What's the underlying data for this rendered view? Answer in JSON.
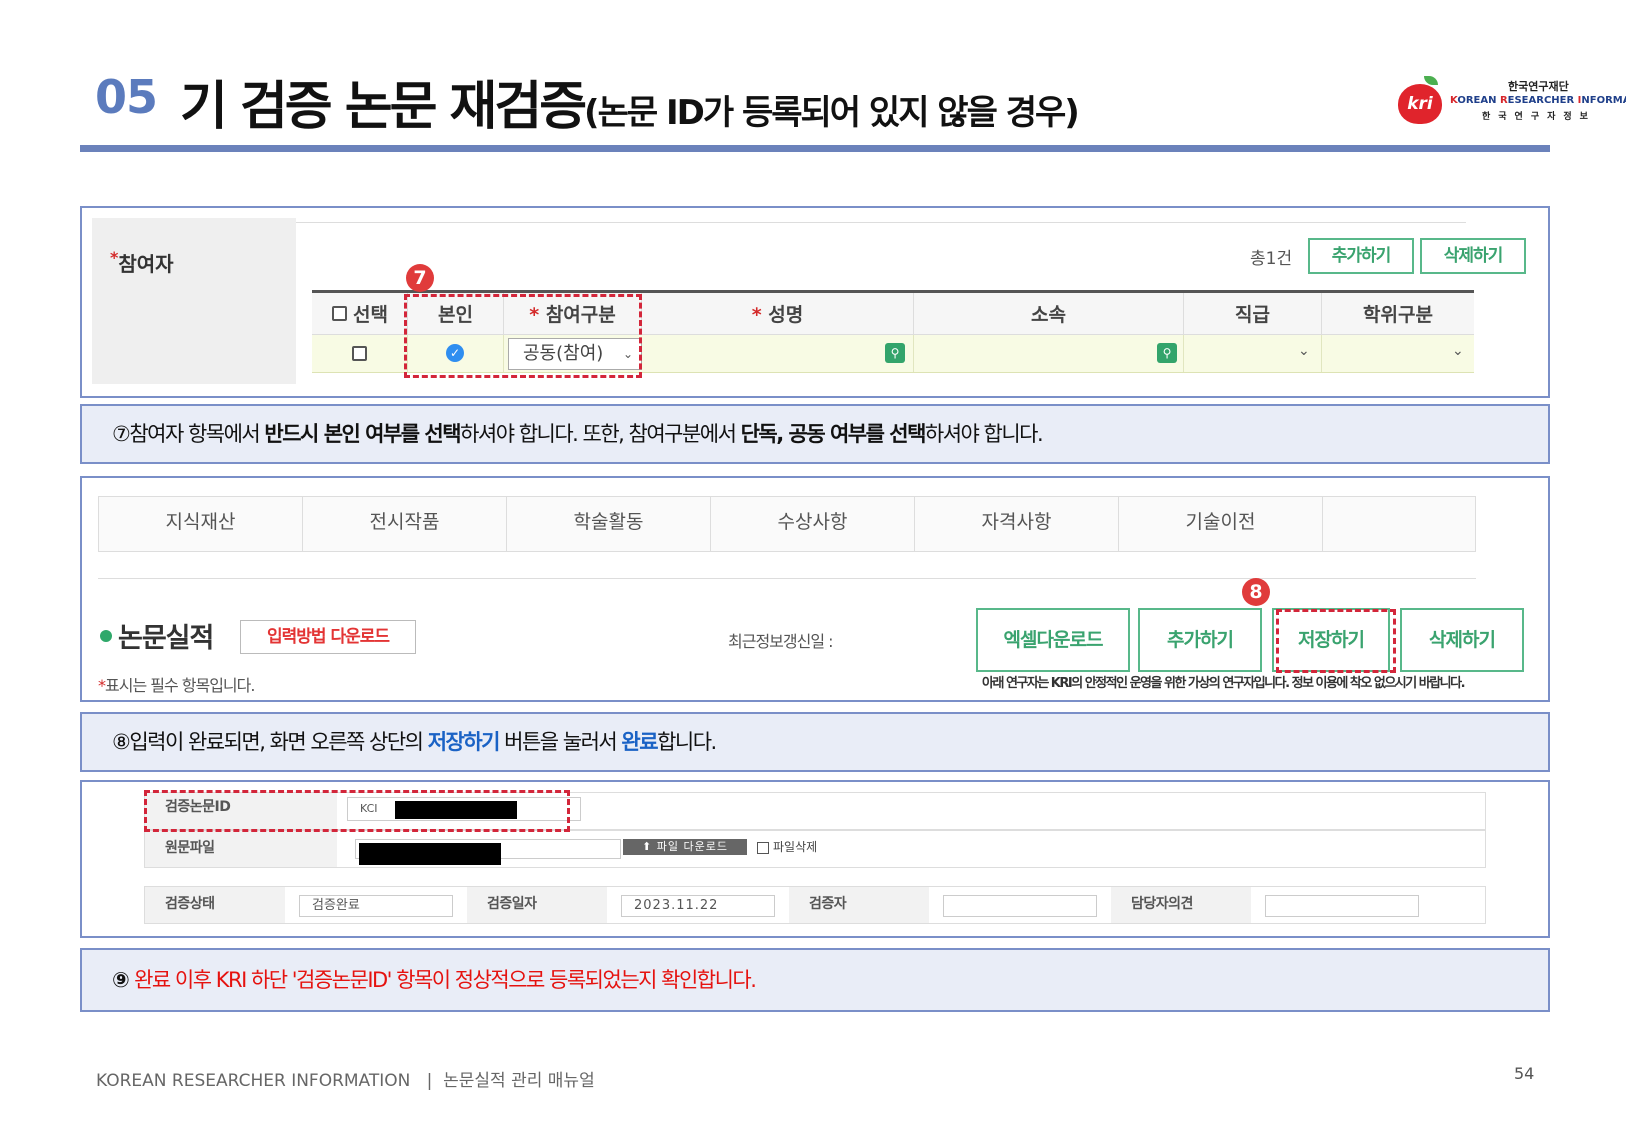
{
  "header": {
    "section_number": "05",
    "title": "기 검증 논문 재검증",
    "title_sub": "(논문 ID가 등록되어 있지 않을 경우)",
    "logo": {
      "mark": "kri",
      "korean_name": "한국연구재단",
      "english_k": "K",
      "english_orean": "OREAN ",
      "english_r": "R",
      "english_esearcher": "ESEARCHER ",
      "english_i": "I",
      "english_nformation": "NFORMATION",
      "korean_sub": "한국연구자정보"
    }
  },
  "panel1": {
    "section_label": "참여자",
    "required_mark": "*",
    "count": "총1건",
    "add_button": "추가하기",
    "delete_button": "삭제하기",
    "badge": "7",
    "columns": [
      "선택",
      "본인",
      "참여구분",
      "성명",
      "소속",
      "직급",
      "학위구분"
    ],
    "row": {
      "participation": "공동(참여)",
      "is_self": true
    }
  },
  "note1": {
    "p1": "⑦참여자 항목에서 ",
    "b1": "반드시 본인 여부를 선택",
    "p2": "하셔야 합니다. 또한, 참여구분에서 ",
    "b2": "단독, 공동 여부를 선택",
    "p3": "하셔야 합니다."
  },
  "panel2": {
    "tabs": [
      "지식재산",
      "전시작품",
      "학술활동",
      "수상사항",
      "자격사항",
      "기술이전",
      ""
    ],
    "title": "논문실적",
    "download_method": "입력방법 다운로드",
    "required_note": "표시는 필수 항목입니다.",
    "required_mark": "*",
    "updated_label": "최근정보갱신일 :",
    "buttons": {
      "excel": "엑셀다운로드",
      "add": "추가하기",
      "save": "저장하기",
      "delete": "삭제하기"
    },
    "badge": "8",
    "notice": "아래 연구자는 KRI의 안정적인 운영을 위한 가상의 연구자입니다. 정보 이용에 착오 없으시기 바랍니다."
  },
  "note2": {
    "p1": "⑧입력이 완료되면, 화면 오른쪽 상단의 ",
    "b1": "저장하기",
    "p2": " 버튼을 눌러서 ",
    "b2": "완료",
    "p3": "합니다."
  },
  "panel3": {
    "verify_id_label": "검증논문ID",
    "verify_id_prefix": "KCI",
    "original_file_label": "원문파일",
    "file_download_button": "파일 다운로드",
    "file_delete_label": "파일삭제",
    "status_label": "검증상태",
    "status_value": "검증완료",
    "date_label": "검증일자",
    "date_value": "2023.11.22",
    "verifier_label": "검증자",
    "opinion_label": "담당자의견"
  },
  "note3": {
    "num": "⑨ ",
    "text": "완료 이후 KRI 하단 '검증논문ID' 항목이 정상적으로 등록되었는지 확인합니다."
  },
  "footer": {
    "left": "KOREAN RESEARCHER INFORMATION",
    "divider": "|",
    "right": "논문실적 관리 매뉴얼",
    "page": "54"
  }
}
